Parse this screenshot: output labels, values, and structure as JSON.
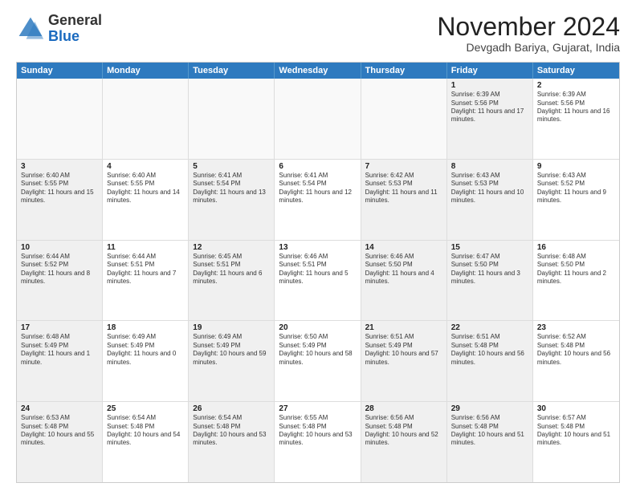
{
  "header": {
    "logo_general": "General",
    "logo_blue": "Blue",
    "month_year": "November 2024",
    "location": "Devgadh Bariya, Gujarat, India"
  },
  "weekdays": [
    "Sunday",
    "Monday",
    "Tuesday",
    "Wednesday",
    "Thursday",
    "Friday",
    "Saturday"
  ],
  "rows": [
    [
      {
        "day": "",
        "info": "",
        "empty": true
      },
      {
        "day": "",
        "info": "",
        "empty": true
      },
      {
        "day": "",
        "info": "",
        "empty": true
      },
      {
        "day": "",
        "info": "",
        "empty": true
      },
      {
        "day": "",
        "info": "",
        "empty": true
      },
      {
        "day": "1",
        "info": "Sunrise: 6:39 AM\nSunset: 5:56 PM\nDaylight: 11 hours and 17 minutes.",
        "shaded": true
      },
      {
        "day": "2",
        "info": "Sunrise: 6:39 AM\nSunset: 5:56 PM\nDaylight: 11 hours and 16 minutes.",
        "shaded": false
      }
    ],
    [
      {
        "day": "3",
        "info": "Sunrise: 6:40 AM\nSunset: 5:55 PM\nDaylight: 11 hours and 15 minutes.",
        "shaded": true
      },
      {
        "day": "4",
        "info": "Sunrise: 6:40 AM\nSunset: 5:55 PM\nDaylight: 11 hours and 14 minutes.",
        "shaded": false
      },
      {
        "day": "5",
        "info": "Sunrise: 6:41 AM\nSunset: 5:54 PM\nDaylight: 11 hours and 13 minutes.",
        "shaded": true
      },
      {
        "day": "6",
        "info": "Sunrise: 6:41 AM\nSunset: 5:54 PM\nDaylight: 11 hours and 12 minutes.",
        "shaded": false
      },
      {
        "day": "7",
        "info": "Sunrise: 6:42 AM\nSunset: 5:53 PM\nDaylight: 11 hours and 11 minutes.",
        "shaded": true
      },
      {
        "day": "8",
        "info": "Sunrise: 6:43 AM\nSunset: 5:53 PM\nDaylight: 11 hours and 10 minutes.",
        "shaded": true
      },
      {
        "day": "9",
        "info": "Sunrise: 6:43 AM\nSunset: 5:52 PM\nDaylight: 11 hours and 9 minutes.",
        "shaded": false
      }
    ],
    [
      {
        "day": "10",
        "info": "Sunrise: 6:44 AM\nSunset: 5:52 PM\nDaylight: 11 hours and 8 minutes.",
        "shaded": true
      },
      {
        "day": "11",
        "info": "Sunrise: 6:44 AM\nSunset: 5:51 PM\nDaylight: 11 hours and 7 minutes.",
        "shaded": false
      },
      {
        "day": "12",
        "info": "Sunrise: 6:45 AM\nSunset: 5:51 PM\nDaylight: 11 hours and 6 minutes.",
        "shaded": true
      },
      {
        "day": "13",
        "info": "Sunrise: 6:46 AM\nSunset: 5:51 PM\nDaylight: 11 hours and 5 minutes.",
        "shaded": false
      },
      {
        "day": "14",
        "info": "Sunrise: 6:46 AM\nSunset: 5:50 PM\nDaylight: 11 hours and 4 minutes.",
        "shaded": true
      },
      {
        "day": "15",
        "info": "Sunrise: 6:47 AM\nSunset: 5:50 PM\nDaylight: 11 hours and 3 minutes.",
        "shaded": true
      },
      {
        "day": "16",
        "info": "Sunrise: 6:48 AM\nSunset: 5:50 PM\nDaylight: 11 hours and 2 minutes.",
        "shaded": false
      }
    ],
    [
      {
        "day": "17",
        "info": "Sunrise: 6:48 AM\nSunset: 5:49 PM\nDaylight: 11 hours and 1 minute.",
        "shaded": true
      },
      {
        "day": "18",
        "info": "Sunrise: 6:49 AM\nSunset: 5:49 PM\nDaylight: 11 hours and 0 minutes.",
        "shaded": false
      },
      {
        "day": "19",
        "info": "Sunrise: 6:49 AM\nSunset: 5:49 PM\nDaylight: 10 hours and 59 minutes.",
        "shaded": true
      },
      {
        "day": "20",
        "info": "Sunrise: 6:50 AM\nSunset: 5:49 PM\nDaylight: 10 hours and 58 minutes.",
        "shaded": false
      },
      {
        "day": "21",
        "info": "Sunrise: 6:51 AM\nSunset: 5:49 PM\nDaylight: 10 hours and 57 minutes.",
        "shaded": true
      },
      {
        "day": "22",
        "info": "Sunrise: 6:51 AM\nSunset: 5:48 PM\nDaylight: 10 hours and 56 minutes.",
        "shaded": true
      },
      {
        "day": "23",
        "info": "Sunrise: 6:52 AM\nSunset: 5:48 PM\nDaylight: 10 hours and 56 minutes.",
        "shaded": false
      }
    ],
    [
      {
        "day": "24",
        "info": "Sunrise: 6:53 AM\nSunset: 5:48 PM\nDaylight: 10 hours and 55 minutes.",
        "shaded": true
      },
      {
        "day": "25",
        "info": "Sunrise: 6:54 AM\nSunset: 5:48 PM\nDaylight: 10 hours and 54 minutes.",
        "shaded": false
      },
      {
        "day": "26",
        "info": "Sunrise: 6:54 AM\nSunset: 5:48 PM\nDaylight: 10 hours and 53 minutes.",
        "shaded": true
      },
      {
        "day": "27",
        "info": "Sunrise: 6:55 AM\nSunset: 5:48 PM\nDaylight: 10 hours and 53 minutes.",
        "shaded": false
      },
      {
        "day": "28",
        "info": "Sunrise: 6:56 AM\nSunset: 5:48 PM\nDaylight: 10 hours and 52 minutes.",
        "shaded": true
      },
      {
        "day": "29",
        "info": "Sunrise: 6:56 AM\nSunset: 5:48 PM\nDaylight: 10 hours and 51 minutes.",
        "shaded": true
      },
      {
        "day": "30",
        "info": "Sunrise: 6:57 AM\nSunset: 5:48 PM\nDaylight: 10 hours and 51 minutes.",
        "shaded": false
      }
    ]
  ]
}
